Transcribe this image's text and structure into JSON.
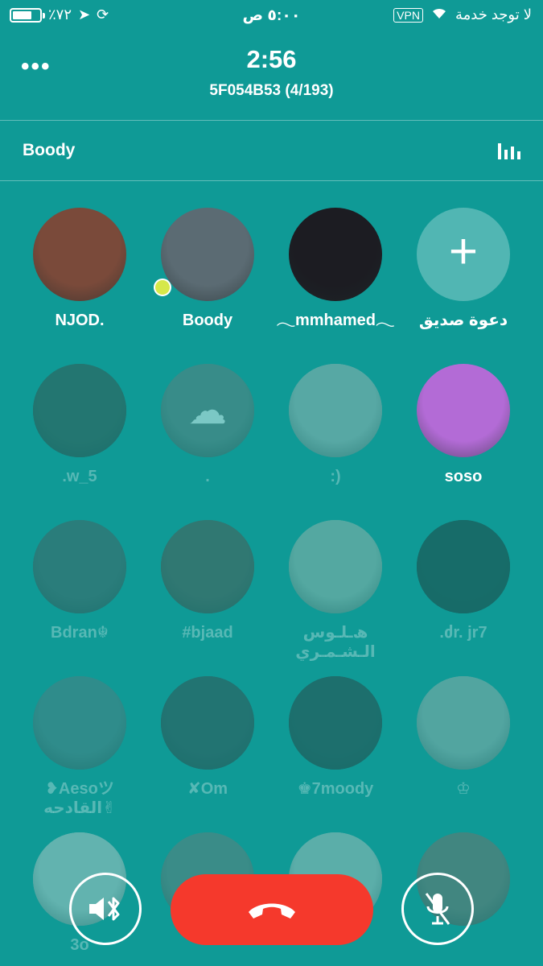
{
  "status_bar": {
    "battery_percent": "٪٧٢",
    "battery_level": 0.72,
    "time": "٥:٠٠ ص",
    "vpn": "VPN",
    "carrier": "لا توجد خدمة"
  },
  "header": {
    "more": "•••",
    "timer": "2:56",
    "room": "5F054B53 (4/193)"
  },
  "speaker": {
    "name": "Boody"
  },
  "participants": [
    {
      "name": "NJOD.",
      "color": "#7a4a3a",
      "active": true
    },
    {
      "name": "Boody",
      "color": "#5b6b73",
      "active": true,
      "badge_color": "#d6e84a"
    },
    {
      "name": "𓂃mmhamed𓂃",
      "color": "#1c1c22",
      "active": true
    },
    {
      "name": "دعوة صديق",
      "invite": true,
      "icon": "plus-icon"
    },
    {
      "name": ".w_5",
      "color": "#3d4a45",
      "active": false
    },
    {
      "name": ".",
      "color": "#6a7b7a",
      "active": false,
      "icon": "placeholder-icon"
    },
    {
      "name": ":)",
      "color": "#b0b8b6",
      "active": false
    },
    {
      "name": "soso",
      "color": "#b36bd6",
      "active": true
    },
    {
      "name": "Bdran☬",
      "color": "#4d5a5c",
      "active": false
    },
    {
      "name": "#bjaad",
      "color": "#5a4e48",
      "active": false
    },
    {
      "name": "ﮪـلـوس الـشـمـري",
      "color": "#a9b9b0",
      "active": false
    },
    {
      "name": ".ძr. jr7",
      "color": "#233333",
      "active": false
    },
    {
      "name": "❥Aesoツ القادحه✌",
      "color": "#587a7e",
      "active": false
    },
    {
      "name": "✘Om",
      "color": "#3b4548",
      "active": false
    },
    {
      "name": "♚7moody",
      "color": "#2f3b3d",
      "active": false
    },
    {
      "name": "♔",
      "color": "#a4b1ae",
      "active": false
    },
    {
      "name": "3o",
      "color": "#c8d0ce",
      "active": false
    },
    {
      "name": "",
      "color": "#6f7b78",
      "active": false
    },
    {
      "name": "",
      "color": "#b9c5c2",
      "active": false
    },
    {
      "name": "",
      "color": "#7e6d67",
      "active": false
    }
  ],
  "controls": {
    "speaker_icon": "speaker-bluetooth-icon",
    "hangup_icon": "phone-hangup-icon",
    "mute_icon": "mic-muted-icon",
    "hangup_color": "#f5392c"
  }
}
